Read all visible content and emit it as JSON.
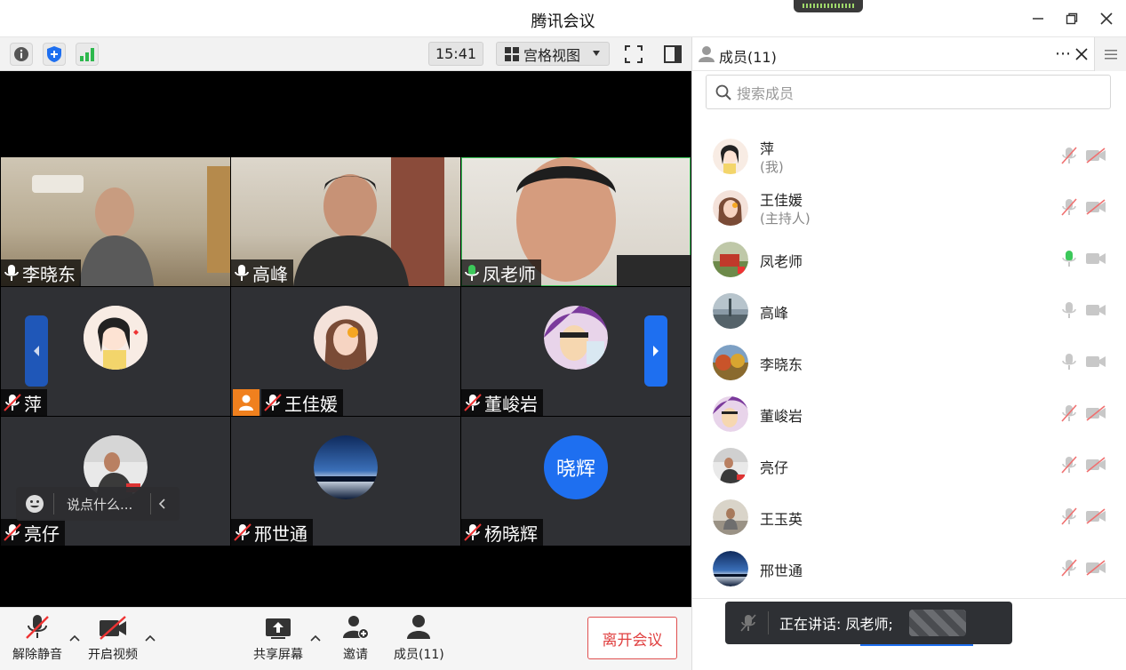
{
  "window": {
    "title": "腾讯会议"
  },
  "toolbar": {
    "time": "15:41",
    "view_label": "宫格视图"
  },
  "tiles": [
    {
      "name": "李晓东"
    },
    {
      "name": "高峰"
    },
    {
      "name": "凤老师"
    },
    {
      "name": "萍"
    },
    {
      "name": "王佳媛"
    },
    {
      "name": "董峻岩"
    },
    {
      "name": "亮仔"
    },
    {
      "name": "邢世通"
    },
    {
      "name": "杨晓辉",
      "avatar_text": "晓辉"
    }
  ],
  "chat": {
    "placeholder": "说点什么..."
  },
  "bottombar": {
    "unmute_label": "解除静音",
    "video_label": "开启视频",
    "share_label": "共享屏幕",
    "invite_label": "邀请",
    "members_label": "成员(11)",
    "leave_label": "离开会议"
  },
  "panel": {
    "title": "成员(11)",
    "search_placeholder": "搜索成员",
    "members": [
      {
        "name": "萍",
        "role": "(我)"
      },
      {
        "name": "王佳媛",
        "role": "(主持人)"
      },
      {
        "name": "凤老师",
        "role": ""
      },
      {
        "name": "高峰",
        "role": ""
      },
      {
        "name": "李晓东",
        "role": ""
      },
      {
        "name": "董峻岩",
        "role": ""
      },
      {
        "name": "亮仔",
        "role": ""
      },
      {
        "name": "王玉英",
        "role": ""
      },
      {
        "name": "邢世通",
        "role": ""
      }
    ]
  },
  "toast": {
    "speaking": "正在讲话: 凤老师;"
  },
  "colors": {
    "accent": "#1e6ff0",
    "speaking_green": "#3cc85a",
    "leave_red": "#e04040",
    "host_orange": "#f0801e"
  }
}
